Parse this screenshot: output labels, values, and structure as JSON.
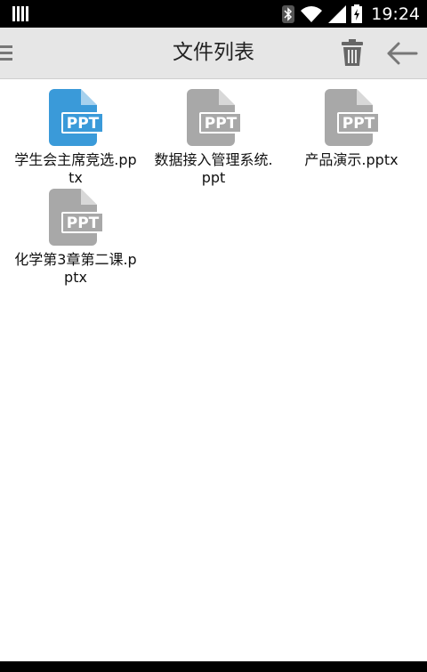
{
  "status_bar": {
    "time": "19:24",
    "icons": [
      "sim-icon",
      "bluetooth-icon",
      "wifi-icon",
      "signal-icon",
      "battery-charging-icon"
    ]
  },
  "app_bar": {
    "title": "文件列表",
    "menu_icon": "menu-icon",
    "delete_icon": "trash-icon",
    "back_icon": "back-arrow-icon"
  },
  "files": [
    {
      "name": "学生会主席竞选.pptx",
      "badge": "PPT",
      "selected": true
    },
    {
      "name": "数据接入管理系统.ppt",
      "badge": "PPT",
      "selected": false
    },
    {
      "name": "产品演示.pptx",
      "badge": "PPT",
      "selected": false
    },
    {
      "name": "化学第3章第二课.pptx",
      "badge": "PPT",
      "selected": false
    }
  ],
  "colors": {
    "selected_icon": "#3a9ad9",
    "normal_icon": "#a8a8a8",
    "app_bar": "#e6e6e6"
  }
}
